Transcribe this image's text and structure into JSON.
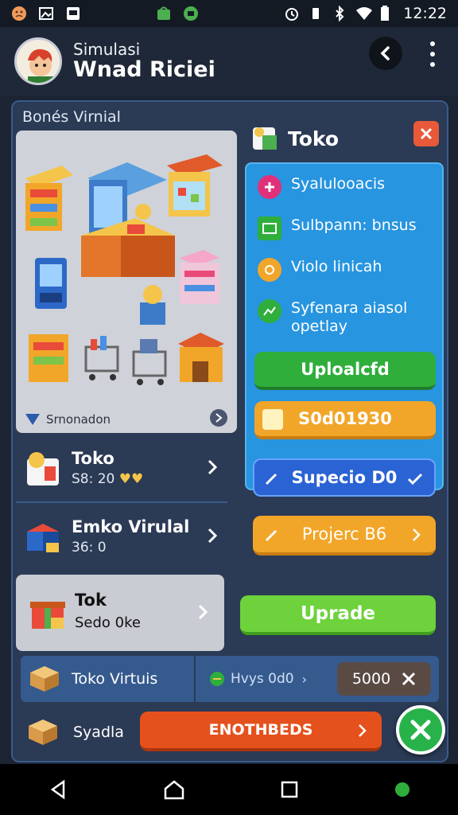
{
  "status_bar": {
    "time": "12:22"
  },
  "header": {
    "title_line1": "Simulasi",
    "title_line2": "Wnad Riciei"
  },
  "panel": {
    "title": "Bonés Virnial"
  },
  "scene": {
    "caption": "Srnonadon"
  },
  "rows": [
    {
      "name": "Toko",
      "sub": "S8: 20"
    },
    {
      "name": "Emko Virulal",
      "sub": "36: 0"
    },
    {
      "name": "Tok",
      "sub": "Sedo 0ke"
    }
  ],
  "toko": {
    "title": "Toko",
    "options": [
      {
        "label": "Syalulooacis",
        "color": "#e0307a",
        "icon": "plus-icon"
      },
      {
        "label": "Sulbpann: bnsus",
        "color": "#2fae3c",
        "icon": "stats-icon"
      },
      {
        "label": "Violo linicah",
        "color": "#f2a629",
        "icon": "coin-icon"
      },
      {
        "label": "Syfenara aiasol\nopetlay",
        "color": "#2fae3c",
        "icon": "chart-icon"
      }
    ],
    "upload_label": "Uploalcfd",
    "price_label": "S0d01930",
    "super_label": "Supecio D0",
    "project_label": "Projerc B6"
  },
  "upgrade_label": "Uprade",
  "bottom_strip": {
    "name": "Toko Virtuis",
    "stat": "Hvys 0d0",
    "amount": "5000"
  },
  "last_row": {
    "name": "Syadla",
    "button_label": "ENOTHBEDS"
  },
  "colors": {
    "accent_blue": "#2795e0",
    "green": "#2fae3c",
    "orange": "#f2a629",
    "red": "#e5511c"
  }
}
